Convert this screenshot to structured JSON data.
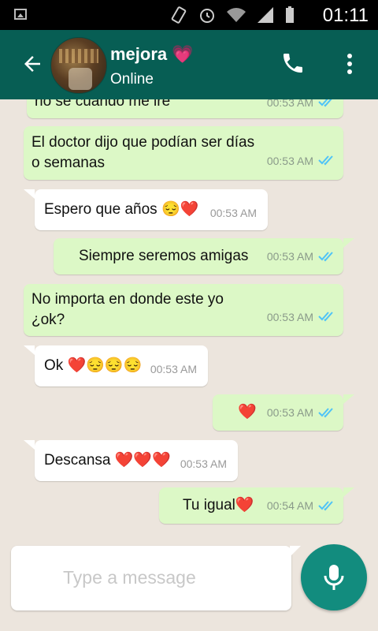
{
  "statusbar": {
    "time": "01:11"
  },
  "header": {
    "name": "mejora 💗",
    "status": "Online"
  },
  "composer": {
    "placeholder": "Type a message"
  },
  "messages": [
    {
      "dir": "out",
      "text": "no se cuando me iré",
      "time": "00:53 AM"
    },
    {
      "dir": "out",
      "text": "El doctor dijo que podían ser días\no semanas",
      "time": "00:53 AM"
    },
    {
      "dir": "in",
      "text": "Espero que años 😔❤️",
      "time": "00:53 AM"
    },
    {
      "dir": "out",
      "text": "Siempre seremos amigas",
      "time": "00:53 AM"
    },
    {
      "dir": "out",
      "text": "No importa en donde este yo\n¿ok?",
      "time": "00:53 AM"
    },
    {
      "dir": "in",
      "text": "Ok ❤️😔😔😔",
      "time": "00:53 AM"
    },
    {
      "dir": "out",
      "text": "❤️",
      "time": "00:53 AM"
    },
    {
      "dir": "in",
      "text": "Descansa ❤️❤️❤️",
      "time": "00:53 AM"
    },
    {
      "dir": "out",
      "text": "Tu igual❤️",
      "time": "00:54 AM"
    }
  ]
}
